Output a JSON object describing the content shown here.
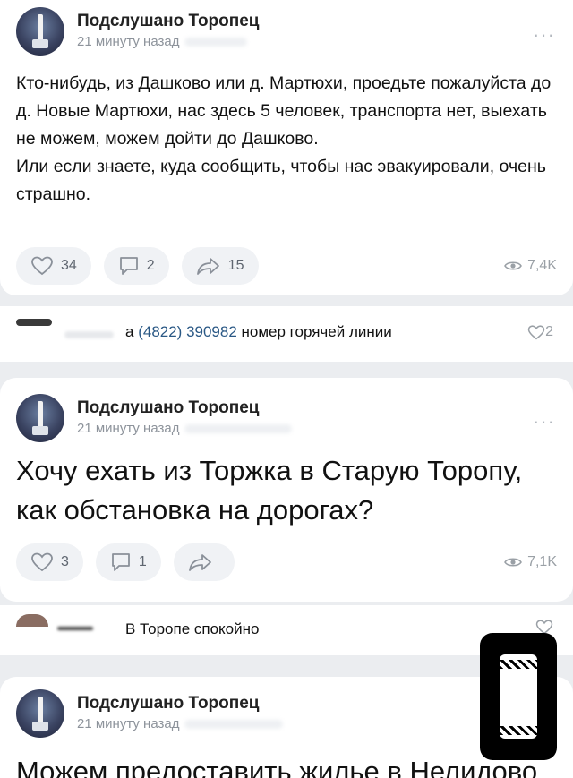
{
  "posts": [
    {
      "group": "Подслушано Торопец",
      "time": "21 минуту назад",
      "text": "Кто-нибудь, из Дашково или д. Мартюхи, проедьте пожалуйста до д. Новые Мартюхи, нас здесь 5 человек, транспорта нет, выехать не можем, можем дойти до Дашково.\nИли если знаете, куда сообщить, чтобы нас эвакуировали, очень страшно.",
      "likes": "34",
      "comments": "2",
      "shares": "15",
      "views": "7,4K"
    },
    {
      "group": "Подслушано Торопец",
      "time": "21 минуту назад",
      "text": "Хочу ехать из Торжка в Старую Торопу, как обстановка на дорогах?",
      "likes": "3",
      "comments": "1",
      "shares": "",
      "views": "7,1K"
    },
    {
      "group": "Подслушано Торопец",
      "time": "21 минуту назад",
      "text": "Можем предоставить жилье в Нелидово"
    }
  ],
  "comments": [
    {
      "prefix": "а",
      "phone": "(4822) 390982",
      "suffix": " номер горячей линии",
      "likes": "2"
    },
    {
      "text": "В Торопе спокойно",
      "likes": ""
    }
  ],
  "more_icon": "more-icon",
  "colors": {
    "link": "#2a5885",
    "meta": "#8d939b",
    "pill_bg": "#f0f2f5",
    "page_bg": "#ebedf0"
  }
}
